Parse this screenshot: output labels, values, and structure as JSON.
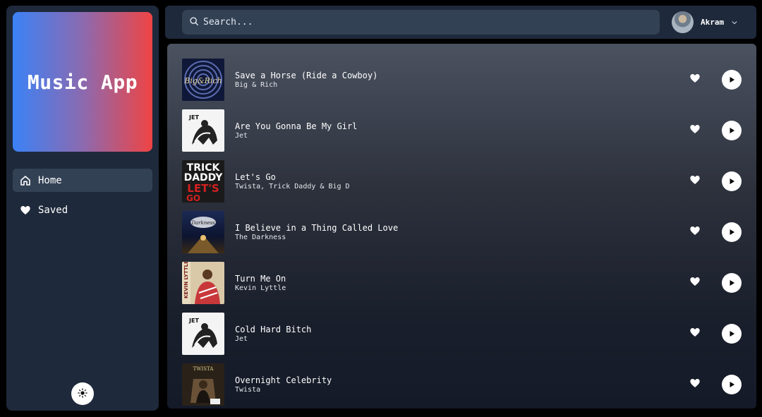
{
  "app": {
    "title": "Music App"
  },
  "sidebar": {
    "items": [
      {
        "label": "Home",
        "icon": "home-icon",
        "active": true
      },
      {
        "label": "Saved",
        "icon": "heart-icon",
        "active": false
      }
    ],
    "theme_toggle_icon": "sun-icon"
  },
  "header": {
    "search_placeholder": "Search...",
    "user_name": "Akram"
  },
  "tracks": [
    {
      "title": "Save a Horse (Ride a Cowboy)",
      "artist": "Big & Rich"
    },
    {
      "title": "Are You Gonna Be My Girl",
      "artist": "Jet"
    },
    {
      "title": "Let's Go",
      "artist": "Twista, Trick Daddy & Big D"
    },
    {
      "title": "I Believe in a Thing Called Love",
      "artist": "The Darkness"
    },
    {
      "title": "Turn Me On",
      "artist": "Kevin Lyttle"
    },
    {
      "title": "Cold Hard Bitch",
      "artist": "Jet"
    },
    {
      "title": "Overnight Celebrity",
      "artist": "Twista"
    }
  ],
  "colors": {
    "sidebar_bg": "#1e293b",
    "active_item_bg": "#334155",
    "gradient_start": "#3b82f6",
    "gradient_end": "#ef4444"
  }
}
